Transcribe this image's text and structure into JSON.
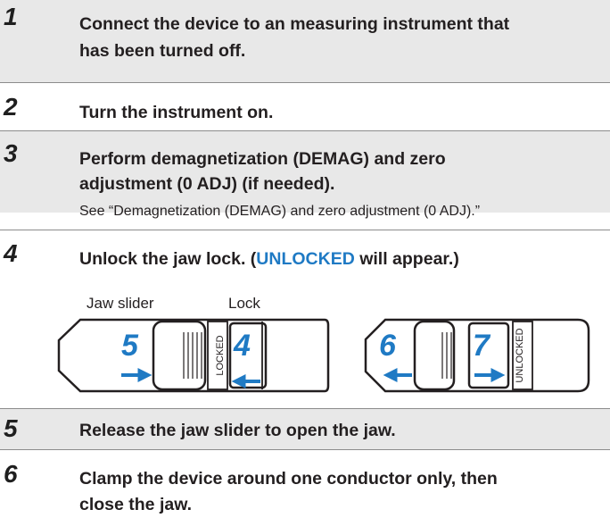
{
  "steps": [
    {
      "number": "1",
      "lines": [
        "Connect the device to an measuring instrument that",
        "has been turned off."
      ]
    },
    {
      "number": "2",
      "lines": [
        "Turn the instrument on."
      ]
    },
    {
      "number": "3",
      "lines": [
        "Perform demagnetization (DEMAG) and zero",
        "adjustment (0 ADJ) (if needed)."
      ],
      "note": "See “Demagnetization (DEMAG) and zero adjustment (0 ADJ).”"
    },
    {
      "number": "4",
      "text_before": "Unlock the jaw lock. (",
      "highlight": "UNLOCKED",
      "text_after": " will appear.)"
    },
    {
      "number": "5",
      "lines": [
        "Release the jaw slider to open the jaw."
      ]
    },
    {
      "number": "6",
      "lines": [
        "Clamp the device around one conductor only, then",
        "close the jaw."
      ]
    }
  ],
  "illustration": {
    "caption_slider": "Jaw slider",
    "caption_lock": "Lock",
    "left_panel": {
      "label": "LOCKED",
      "marks": [
        "5",
        "4"
      ]
    },
    "right_panel": {
      "label": "UNLOCKED",
      "marks": [
        "6",
        "7"
      ]
    },
    "accent_color": "#1f7ac4"
  },
  "colors": {
    "step_band": "#e8e8e8",
    "highlight": "#1f7ac4",
    "divider": "#8c8c8c"
  }
}
